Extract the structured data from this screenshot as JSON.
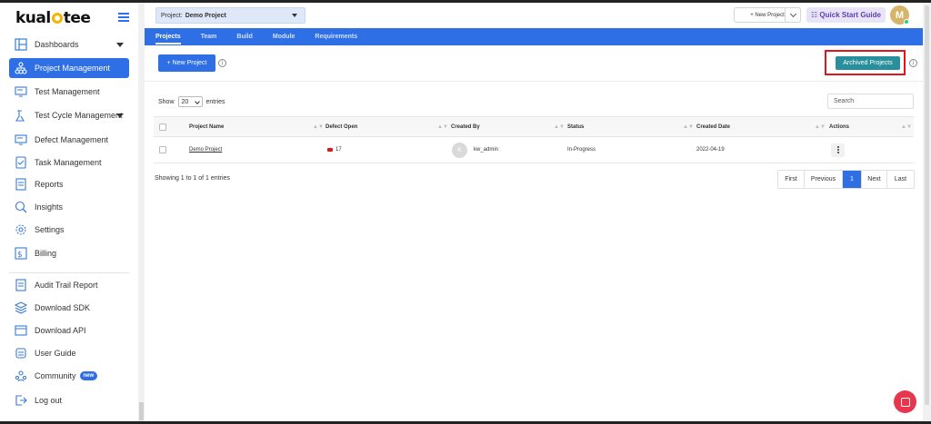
{
  "brand": {
    "logo_text_pre": "kual",
    "logo_text_post": "tee"
  },
  "sidebar": {
    "items": [
      {
        "label": "Dashboards",
        "icon": "dashboard-icon"
      },
      {
        "label": "Project Management",
        "icon": "project-tree-icon",
        "active": true
      },
      {
        "label": "Test Management",
        "icon": "test-management-icon"
      },
      {
        "label": "Test Cycle Management",
        "icon": "test-cycle-icon"
      },
      {
        "label": "Defect Management",
        "icon": "defect-icon"
      },
      {
        "label": "Task Management",
        "icon": "task-icon"
      },
      {
        "label": "Reports",
        "icon": "reports-icon"
      },
      {
        "label": "Insights",
        "icon": "insights-icon"
      },
      {
        "label": "Settings",
        "icon": "settings-icon"
      },
      {
        "label": "Billing",
        "icon": "billing-icon"
      },
      {
        "label": "Audit Trail Report",
        "icon": "audit-icon"
      },
      {
        "label": "Download SDK",
        "icon": "sdk-icon"
      },
      {
        "label": "Download API",
        "icon": "api-icon"
      },
      {
        "label": "User Guide",
        "icon": "user-guide-icon"
      },
      {
        "label": "Community",
        "icon": "community-icon",
        "badge": "new"
      },
      {
        "label": "Log out",
        "icon": "logout-icon"
      }
    ]
  },
  "header": {
    "project_prefix": "Project:",
    "project_name": "Demo Project",
    "new_project_label": "+ New Project",
    "quick_start_label": "☷ Quick Start Guide",
    "avatar_initial": "M"
  },
  "tabs": [
    "Projects",
    "Team",
    "Build",
    "Module",
    "Requirements"
  ],
  "toolbar": {
    "new_project_label": "+ New Project",
    "archived_label": "Archived Projects",
    "info_glyph": "i"
  },
  "table_controls": {
    "show_label": "Show",
    "entries_value": "20",
    "entries_label": "entries",
    "search_placeholder": "Search"
  },
  "table": {
    "headers": [
      "Project Name",
      "Defect Open",
      "Created By",
      "Status",
      "Created Date",
      "Actions"
    ],
    "rows": [
      {
        "project_name": "Demo Project",
        "defect_open": "17",
        "created_by_initial": "K",
        "created_by": "kw_admin",
        "status": "In-Progress",
        "created_date": "2022-04-19"
      }
    ]
  },
  "footer": {
    "showing_text": "Showing 1 to 1 of 1 entries",
    "pager": [
      "First",
      "Previous",
      "1",
      "Next",
      "Last"
    ]
  },
  "colors": {
    "primary": "#2f6fe5",
    "archived": "#2a8f9c",
    "highlight": "#e0161b",
    "chat": "#e8364e"
  }
}
